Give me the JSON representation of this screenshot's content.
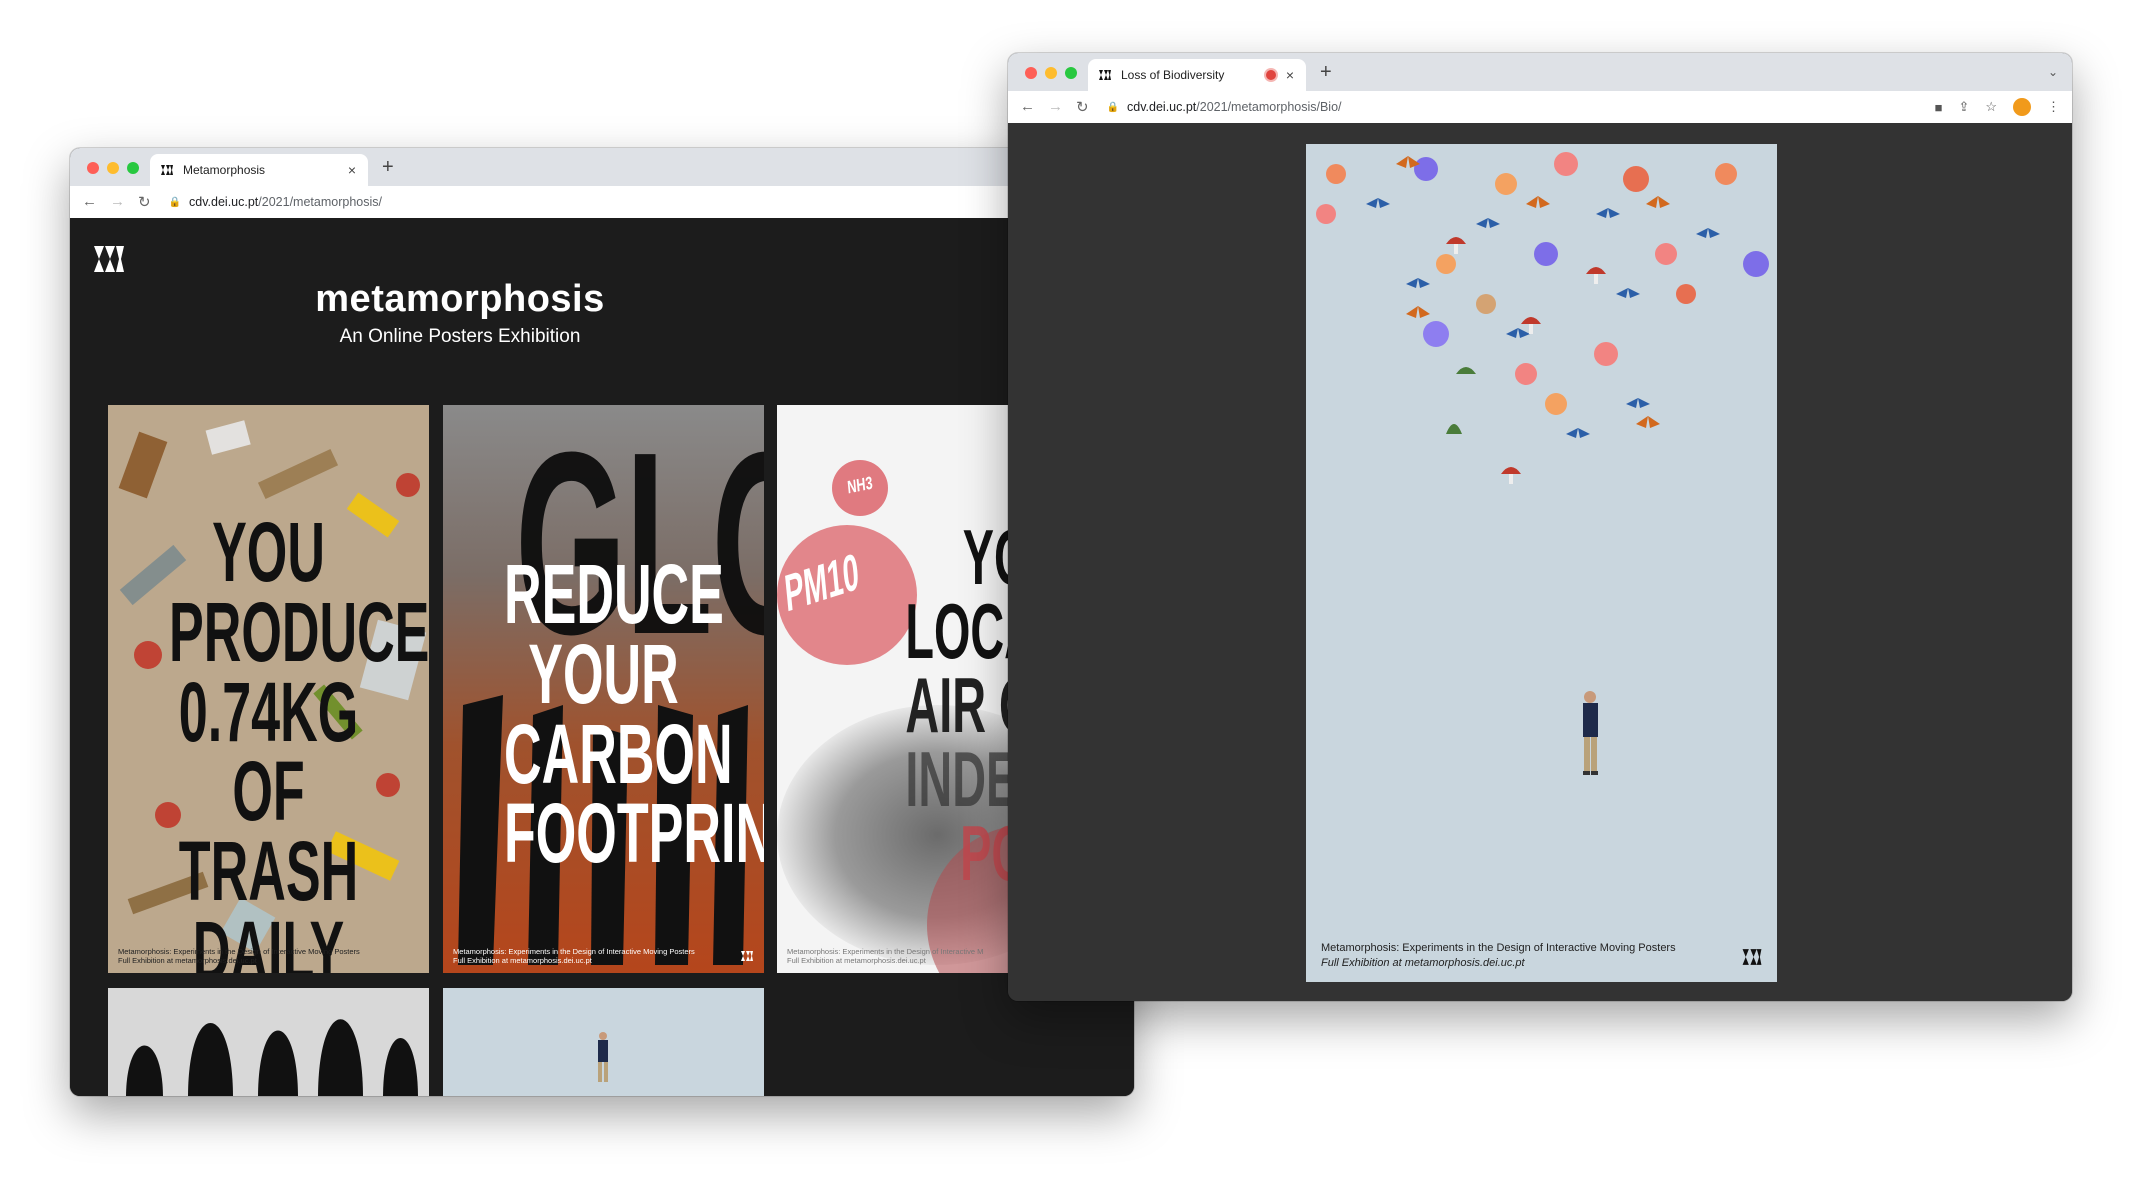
{
  "left_window": {
    "tab_title": "Metamorphosis",
    "tab_close": "×",
    "new_tab": "+",
    "url_host": "cdv.dei.uc.pt",
    "url_path": "/2021/metamorphosis/",
    "site": {
      "title": "metamorphosis",
      "subtitle": "An Online Posters Exhibition"
    },
    "posters": [
      {
        "lines": [
          "YOU",
          "PRODUCE",
          "0.74KG OF",
          "TRASH",
          "DAILY"
        ],
        "footer_line1": "Metamorphosis: Experiments in the Design of Interactive Moving Posters",
        "footer_line2": "Full Exhibition at metamorphosis.dei.uc.pt"
      },
      {
        "background_word": "GLOBAL",
        "lines": [
          "REDUCE",
          "YOUR",
          "CARBON",
          "FOOTPRINT"
        ],
        "footer_line1": "Metamorphosis: Experiments in the Design of Interactive Moving Posters",
        "footer_line2": "Full Exhibition at metamorphosis.dei.uc.pt"
      },
      {
        "badge1": "NH3",
        "badge2": "PM10",
        "lines": [
          "YOUR",
          "LOCATIO",
          "AIR QUALI",
          "INDEX IS",
          "POOR"
        ],
        "footer_line1": "Metamorphosis: Experiments in the Design of Interactive M",
        "footer_line2": "Full Exhibition at metamorphosis.dei.uc.pt"
      }
    ]
  },
  "right_window": {
    "tab_title": "Loss of Biodiversity",
    "tab_close": "×",
    "new_tab": "+",
    "tab_menu": "⌄",
    "url_host": "cdv.dei.uc.pt",
    "url_path": "/2021/metamorphosis/Bio/",
    "poster": {
      "footer_line1": "Metamorphosis: Experiments in the Design of Interactive Moving Posters",
      "footer_line2": "Full Exhibition at metamorphosis.dei.uc.pt"
    }
  },
  "colors": {
    "traffic_red": "#fe5f57",
    "traffic_yellow": "#febc2e",
    "traffic_green": "#28c840",
    "page_dark": "#1c1c1c",
    "bio_bg": "#c9d6de",
    "poster_orange": "#b5461c",
    "pink_badge": "#e07a80"
  }
}
